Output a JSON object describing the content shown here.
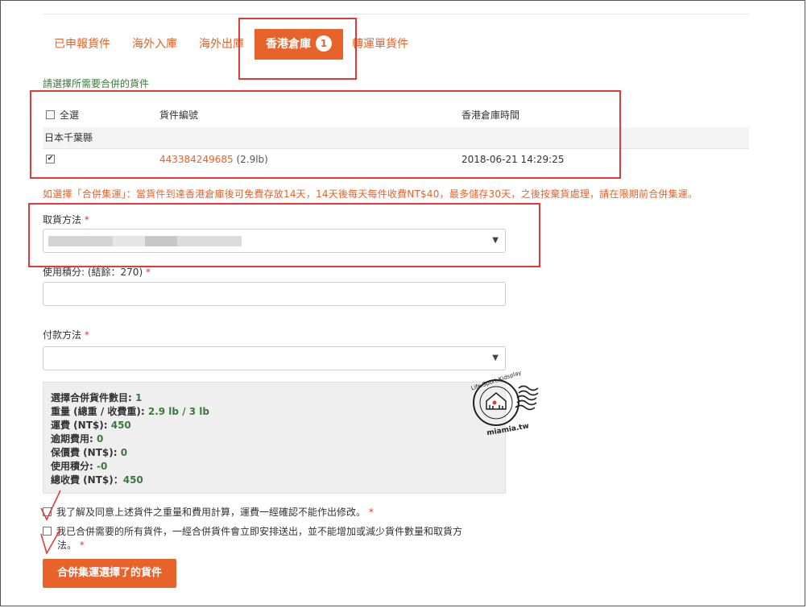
{
  "tabs": [
    {
      "label": "已申報貨件",
      "active": false
    },
    {
      "label": "海外入庫",
      "active": false
    },
    {
      "label": "海外出庫",
      "active": false
    },
    {
      "label": "香港倉庫",
      "active": true,
      "badge": "1"
    },
    {
      "label": "轉運單貨件",
      "active": false
    }
  ],
  "section_title": "請選擇所需要合併的貨件",
  "table": {
    "headers": {
      "select_all": "全選",
      "tracking": "貨件編號",
      "time": "香港倉庫時間"
    },
    "group": "日本千葉縣",
    "rows": [
      {
        "checked": true,
        "tracking": "443384249685",
        "weight": "(2.9lb)",
        "time": "2018-06-21 14:29:25"
      }
    ]
  },
  "notice": "如選擇「合併集運」：當貨件到達香港倉庫後可免費存放14天，14天後每天每件收費NT$40，最多儲存30天，之後按棄貨處理，請在限期前合併集運。",
  "pickup": {
    "label": "取貨方法",
    "required": "*",
    "value": ""
  },
  "points": {
    "label": "使用積分: (結餘：270)",
    "required": "*",
    "value": ""
  },
  "payment": {
    "label": "付款方法",
    "required": "*",
    "value": ""
  },
  "summary": {
    "count_label": "選擇合併貨件數目:",
    "count_value": "1",
    "weight_label": "重量 (總重 / 收費重):",
    "weight_value": "2.9 lb / 3 lb",
    "shipping_label": "運費 (NT$):",
    "shipping_value": "450",
    "overdue_label": "逾期費用:",
    "overdue_value": "0",
    "insurance_label": "保價費 (NT$):",
    "insurance_value": "0",
    "points_label": "使用積分:",
    "points_value": "-0",
    "total_label": "總收費 (NT$)：",
    "total_value": "450"
  },
  "agreements": [
    {
      "text": "我了解及同意上述貨件之重量和費用計算，運費一經確認不能作出修改。",
      "required": "*"
    },
    {
      "text_line1": "我已合併需要的所有貨件，一經合併貨件會立即安排送出，並不能增加或減少貨件數量和取貨方",
      "text_line2": "法。",
      "required": "*"
    }
  ],
  "submit_label": "合併集運選擇了的貨件",
  "watermark": {
    "top_text": "Life.Sport.Kidsplay",
    "bottom_text": "miamia.tw"
  },
  "colors": {
    "accent": "#e8632a",
    "green": "#3c7a3c",
    "annotation_red": "#e03a3a"
  }
}
